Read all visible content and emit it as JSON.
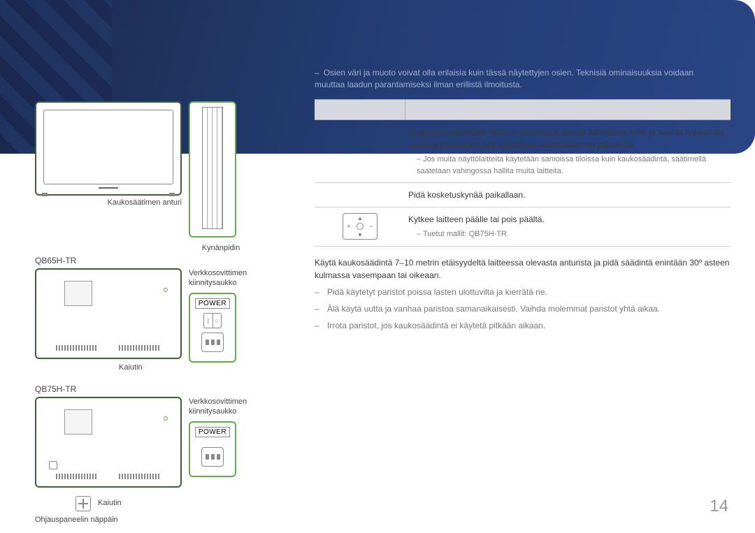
{
  "banner_disclaimer": "Osien väri ja muoto voivat olla erilaisia kuin tässä näytettyjen osien. Teknisiä ominaisuuksia voidaan muuttaa laadun parantamiseksi ilman erillistä ilmoitusta.",
  "labels": {
    "remote_sensor": "Kaukosäätimen anturi",
    "pen_holder": "Kynänpidin",
    "model_65": "QB65H-TR",
    "power_cord_hole": "Verkkosovittimen kiinnitysaukko",
    "power_word": "POWER",
    "speaker": "Kaiutin",
    "model_75": "QB75H-TR",
    "control_panel_key": "Ohjauspaneelin näppäin"
  },
  "table": {
    "row1": {
      "desc": "Suuntaa kaukosäädin laitteen etuosassa olevaa tunnistinta kohti ja suorita haluamasi toiminto painamalla sitä vastaavaa kaukosäätimen painiketta.",
      "note": "Jos muita näyttölaitteita käytetään samoissa tiloissa kuin kaukosäädintä, säätimellä saatetaan vahingossa hallita muita laitteita."
    },
    "row2": {
      "desc": "Pidä kosketuskynää paikallaan."
    },
    "row3": {
      "desc": "Kytkee laitteen päälle tai pois päältä.",
      "note": "Tuetut mallit: QB75H-TR"
    }
  },
  "notes": {
    "distance": "Käytä kaukosäädintä 7–10 metrin etäisyydeltä laitteessa olevasta anturista ja pidä säädintä enintään 30º asteen kulmassa vasempaan tai oikeaan.",
    "b1": "Pidä käytetyt paristot poissa lasten ulottuvilta ja kierrätä ne.",
    "b2": "Älä käytä uutta ja vanhaa paristoa samanaikaisesti. Vaihda molemmat paristot yhtä aikaa.",
    "b3": "Irrota paristot, jos kaukosäädintä ei käytetä pitkään aikaan."
  },
  "page_number": "14"
}
